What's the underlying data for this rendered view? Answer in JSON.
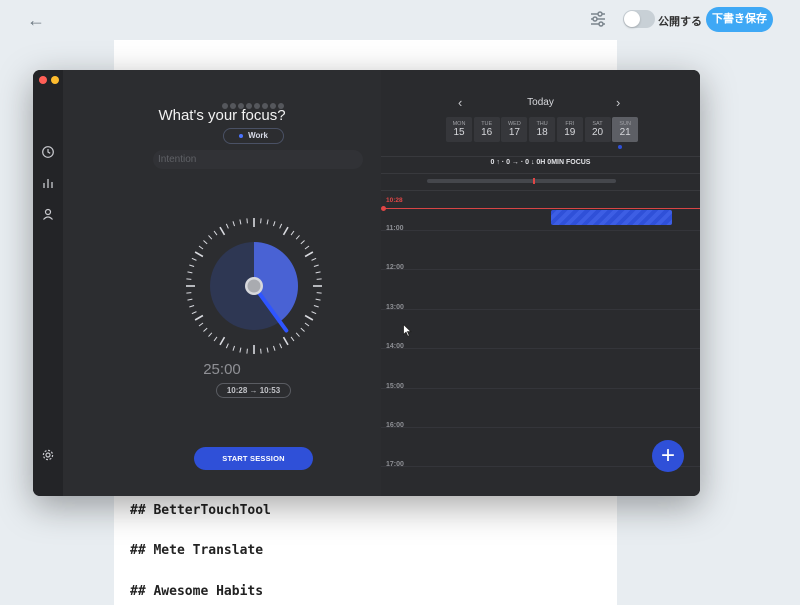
{
  "header": {
    "back_icon": "←",
    "publish_label": "公開する",
    "draft_button": "下書き保存",
    "publish_on": false
  },
  "document": {
    "headings": [
      "## BetterTouchTool",
      "## Mete Translate",
      "## Awesome Habits"
    ]
  },
  "app": {
    "focus_question": "What's your focus?",
    "category_tag": "Work",
    "intention_placeholder": "Intention",
    "timer_value": "25:00",
    "time_range": "10:28 → 10:53",
    "start_button": "START SESSION",
    "progress_dots": 8,
    "timer_fill_fraction": 0.4,
    "calendar": {
      "title": "Today",
      "days": [
        {
          "name": "MON",
          "num": "15"
        },
        {
          "name": "TUE",
          "num": "16"
        },
        {
          "name": "WED",
          "num": "17"
        },
        {
          "name": "THU",
          "num": "18"
        },
        {
          "name": "FRI",
          "num": "19"
        },
        {
          "name": "SAT",
          "num": "20"
        },
        {
          "name": "SUN",
          "num": "21"
        }
      ],
      "selected_day": "21",
      "focus_summary": "0 ↑ · 0 → · 0 ↓   0H 0MIN FOCUS",
      "now_time": "10:28",
      "hours": [
        "11:00",
        "12:00",
        "13:00",
        "14:00",
        "15:00",
        "16:00",
        "17:00"
      ],
      "add_button": "+"
    },
    "colors": {
      "accent": "#2f50d8",
      "now_line": "#e04646",
      "publish_button": "#3ea8f5"
    }
  }
}
